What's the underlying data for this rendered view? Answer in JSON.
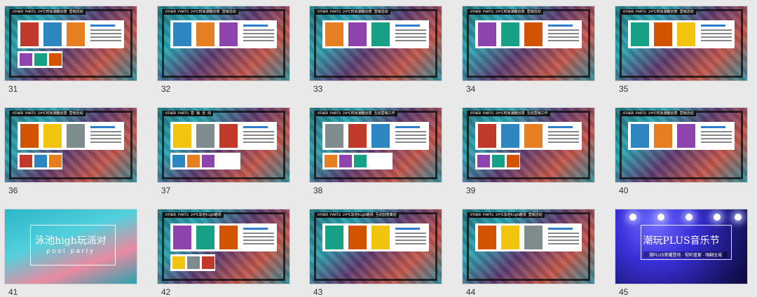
{
  "slides": [
    {
      "num": "31",
      "header": "OTHER PARTS  24℃时尚潮趣创意  营销活动"
    },
    {
      "num": "32",
      "header": "OTHER PARTS  24℃时尚潮趣创意  营销活动"
    },
    {
      "num": "33",
      "header": "OTHER PARTS  24℃时尚潮趣创意  营销活动"
    },
    {
      "num": "34",
      "header": "OTHER PARTS  24℃时尚潮趣创意  营销活动"
    },
    {
      "num": "35",
      "header": "OTHER PARTS  24℃时尚潮趣创意  营销活动"
    },
    {
      "num": "36",
      "header": "OTHER PARTS  24℃时尚潮趣创意  营销活动"
    },
    {
      "num": "37",
      "header": "OTHER PARTS  营 销 活 动"
    },
    {
      "num": "38",
      "header": "OTHER PARTS  24℃时尚潮趣创意  互动营销工作"
    },
    {
      "num": "39",
      "header": "OTHER PARTS  24℃时尚潮趣创意  互动营销工作"
    },
    {
      "num": "40",
      "header": "OTHER PARTS  24℃时尚潮趣创意  营销活动"
    },
    {
      "num": "41",
      "title": "泳池high玩派对",
      "subtitle": "pool  party"
    },
    {
      "num": "42",
      "header": "OTHER PARTS  24℃泳池high趣场"
    },
    {
      "num": "43",
      "header": "OTHER PARTS  24℃泳池high趣场  互动创意策划"
    },
    {
      "num": "44",
      "header": "OTHER PARTS  24℃泳池high趣场  营销活动"
    },
    {
      "num": "45",
      "title": "潮玩PLUS音乐节",
      "subtitle": "潮PLUS荣耀登场 · 视听盛宴 · 嗨翻全城"
    }
  ],
  "colors": {
    "background": "#e9e9ea",
    "accent": "#2f7fcf"
  }
}
